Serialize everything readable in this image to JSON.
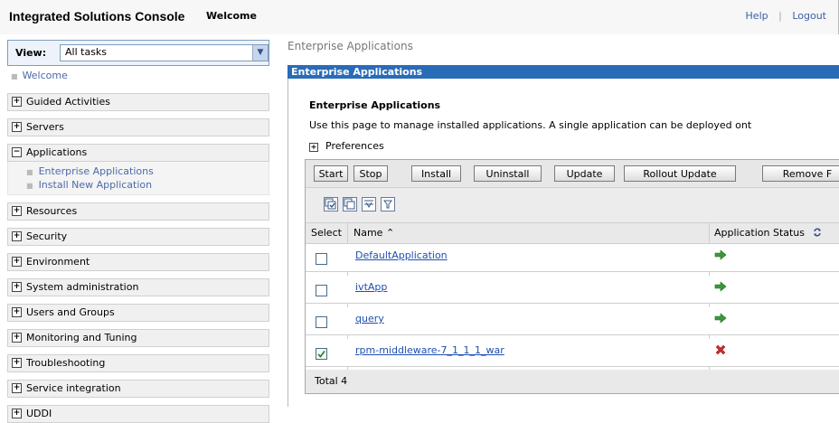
{
  "header": {
    "brand": "Integrated Solutions Console",
    "page_title": "Welcome",
    "help": "Help",
    "separator": "|",
    "logout": "Logout"
  },
  "sidebar": {
    "view_label": "View:",
    "view_value": "All tasks",
    "welcome_link": "Welcome",
    "items": [
      {
        "label": "Guided Activities",
        "expanded": false
      },
      {
        "label": "Servers",
        "expanded": false
      },
      {
        "label": "Applications",
        "expanded": true
      },
      {
        "label": "Resources",
        "expanded": false
      },
      {
        "label": "Security",
        "expanded": false
      },
      {
        "label": "Environment",
        "expanded": false
      },
      {
        "label": "System administration",
        "expanded": false
      },
      {
        "label": "Users and Groups",
        "expanded": false
      },
      {
        "label": "Monitoring and Tuning",
        "expanded": false
      },
      {
        "label": "Troubleshooting",
        "expanded": false
      },
      {
        "label": "Service integration",
        "expanded": false
      },
      {
        "label": "UDDI",
        "expanded": false
      }
    ],
    "applications_sub": [
      "Enterprise Applications",
      "Install New Application"
    ],
    "expand_glyph": "+",
    "collapse_glyph": "−"
  },
  "main": {
    "breadcrumb": "Enterprise Applications",
    "portlet_title": "Enterprise Applications",
    "section_title": "Enterprise Applications",
    "description": "Use this page to manage installed applications. A single application can be deployed ont",
    "preferences": "Preferences",
    "buttons": [
      "Start",
      "Stop",
      "Install",
      "Uninstall",
      "Update",
      "Rollout Update",
      "Remove F"
    ],
    "columns": {
      "select": "Select",
      "name": "Name ⌃",
      "status": "Application Status"
    },
    "rows": [
      {
        "name": "DefaultApplication",
        "checked": false,
        "status": "running"
      },
      {
        "name": "ivtApp",
        "checked": false,
        "status": "running"
      },
      {
        "name": "query",
        "checked": false,
        "status": "running"
      },
      {
        "name": "rpm-middleware-7_1_1_1_war",
        "checked": true,
        "status": "stopped"
      }
    ],
    "total": "Total 4"
  },
  "colors": {
    "portlet_header": "#2a6bb8",
    "link": "#1f4fb0",
    "running": "#3a9a3a",
    "stopped": "#cc2a2a"
  }
}
